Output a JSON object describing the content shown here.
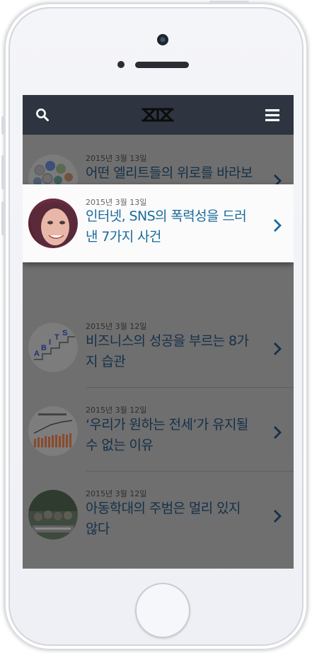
{
  "accent_color": "#1a6a9c",
  "dim_title_color": "#153049",
  "topbar_color": "#2e3540",
  "icons": {
    "search": "search-icon",
    "logo": "logo-icon",
    "menu": "hamburger-menu-icon",
    "chevron": "chevron-right-icon"
  },
  "articles": [
    {
      "date": "2015년 3월 13일",
      "title": "어떤 엘리트들의 위로를 바라보며",
      "thumb": "emblems-thumbnail"
    },
    {
      "date": "2015년 3월 13일",
      "title": "인터넷, SNS의 폭력성을 드러낸 7가지 사건",
      "thumb": "face-thumbnail",
      "selected": true
    },
    {
      "date": "2015년 3월 12일",
      "title": "비즈니스의 성공을 부르는 8가지 습관",
      "thumb": "stairs-thumbnail"
    },
    {
      "date": "2015년 3월 12일",
      "title": "‘우리가 원하는 전세’가 유지될 수 없는 이유",
      "thumb": "bar-chart-thumbnail"
    },
    {
      "date": "2015년 3월 12일",
      "title": "아동학대의 주범은 멀리 있지 않다",
      "thumb": "crowd-photo-thumbnail"
    }
  ]
}
